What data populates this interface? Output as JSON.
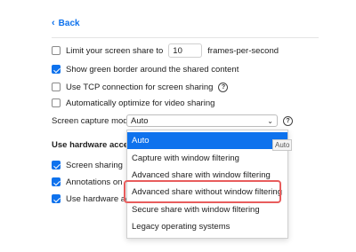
{
  "nav": {
    "back_label": "Back"
  },
  "settings": {
    "limit_share_prefix": "Limit your screen share to",
    "limit_share_value": "10",
    "limit_share_suffix": "frames-per-second",
    "green_border": "Show green border around the shared content",
    "tcp_connection": "Use TCP connection for screen sharing",
    "optimize_video": "Automatically optimize for video sharing",
    "capture_mode_label": "Screen capture mode",
    "capture_mode_value": "Auto",
    "hw_section_title": "Use hardware acceler",
    "hw_screen_sharing": "Screen sharing",
    "hw_annotations": "Annotations on",
    "hw_use_hardware": "Use hardware acce"
  },
  "dropdown": {
    "options": [
      "Auto",
      "Capture with window filtering",
      "Advanced share with window filtering",
      "Advanced share without window filtering",
      "Secure share with window filtering",
      "Legacy operating systems"
    ],
    "selected_index": 0,
    "highlighted_index": 3
  },
  "tooltip": {
    "text": "Auto"
  },
  "colors": {
    "accent": "#0e72ed",
    "highlight_border": "#e85c5c"
  }
}
